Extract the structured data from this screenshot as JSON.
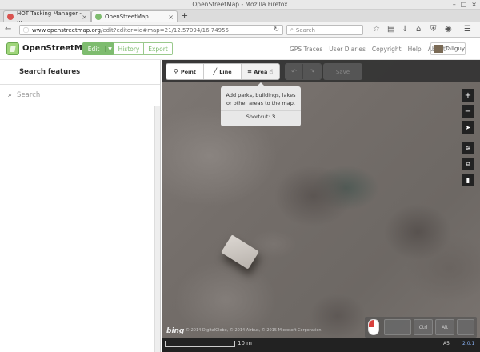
{
  "browser": {
    "window_title": "OpenStreetMap - Mozilla Firefox",
    "tabs": [
      {
        "label": "HOT Tasking Manager - ...",
        "active": false,
        "icon_color": "#d9534f"
      },
      {
        "label": "OpenStreetMap",
        "active": true,
        "icon_color": "#7ebc6f"
      }
    ],
    "new_tab": "+",
    "url_domain": "www.openstreetmap.org",
    "url_path": "/edit?editor=id#map=21/12.57094/16.74955",
    "search_placeholder": "Search"
  },
  "header": {
    "brand": "OpenStreetMap",
    "edit_label": "Edit",
    "history_label": "History",
    "export_label": "Export",
    "links": [
      "GPS Traces",
      "User Diaries",
      "Copyright",
      "Help",
      "About"
    ],
    "user": "Tallguy"
  },
  "sidebar": {
    "title": "Search features",
    "search_placeholder": "Search"
  },
  "toolbar": {
    "point": "Point",
    "line": "Line",
    "area": "Area",
    "save": "Save"
  },
  "tooltip": {
    "text": "Add parks, buildings, lakes or other areas to the map.",
    "shortcut_label": "Shortcut:",
    "shortcut_key": "3"
  },
  "map": {
    "imagery": "bing",
    "attribution": "© 2014 DigitalGlobe, © 2014 Airbus, © 2015 Microsoft Corporation",
    "scale_label": "10 m",
    "footer_user": "A5",
    "version": "2.0.1"
  },
  "key_overlay": {
    "keys": [
      "",
      "Ctrl",
      "Alt",
      ""
    ]
  }
}
